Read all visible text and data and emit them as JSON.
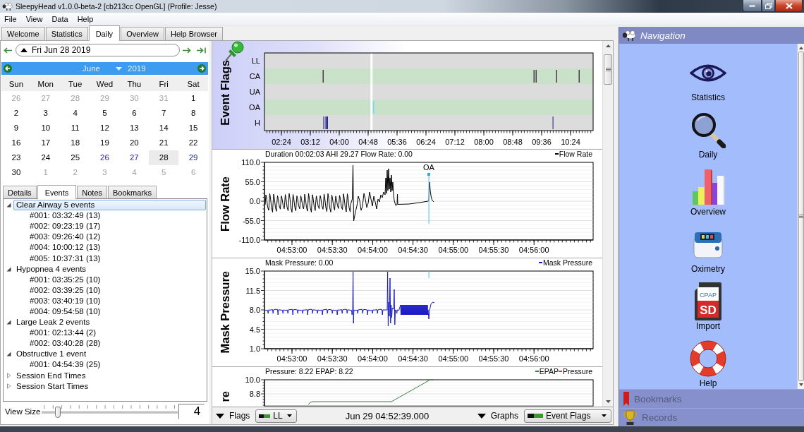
{
  "window": {
    "title": "SleepyHead v1.0.0-beta-2 [cb213cc OpenGL] (Profile: Jesse)"
  },
  "menu": [
    "File",
    "View",
    "Data",
    "Help"
  ],
  "tabs": [
    {
      "label": "Welcome",
      "selected": false
    },
    {
      "label": "Statistics",
      "selected": false
    },
    {
      "label": "Daily",
      "selected": true
    },
    {
      "label": "Overview",
      "selected": false
    },
    {
      "label": "Help Browser",
      "selected": false
    }
  ],
  "date_bar": {
    "date": "Fri Jun 28 2019"
  },
  "calendar": {
    "month": "June",
    "year": "2019",
    "weekdays": [
      "Sun",
      "Mon",
      "Tue",
      "Wed",
      "Thu",
      "Fri",
      "Sat"
    ],
    "weeks": [
      [
        {
          "label": "26",
          "muted": true,
          "has_data": false,
          "selected": false
        },
        {
          "label": "27",
          "muted": true,
          "has_data": false,
          "selected": false
        },
        {
          "label": "28",
          "muted": true,
          "has_data": false,
          "selected": false
        },
        {
          "label": "29",
          "muted": true,
          "has_data": false,
          "selected": false
        },
        {
          "label": "30",
          "muted": true,
          "has_data": false,
          "selected": false
        },
        {
          "label": "31",
          "muted": true,
          "has_data": false,
          "selected": false
        },
        {
          "label": "1",
          "muted": false,
          "has_data": false,
          "selected": false
        }
      ],
      [
        {
          "label": "2",
          "muted": false,
          "has_data": false,
          "selected": false
        },
        {
          "label": "3",
          "muted": false,
          "has_data": false,
          "selected": false
        },
        {
          "label": "4",
          "muted": false,
          "has_data": false,
          "selected": false
        },
        {
          "label": "5",
          "muted": false,
          "has_data": false,
          "selected": false
        },
        {
          "label": "6",
          "muted": false,
          "has_data": false,
          "selected": false
        },
        {
          "label": "7",
          "muted": false,
          "has_data": false,
          "selected": false
        },
        {
          "label": "8",
          "muted": false,
          "has_data": false,
          "selected": false
        }
      ],
      [
        {
          "label": "9",
          "muted": false,
          "has_data": false,
          "selected": false
        },
        {
          "label": "10",
          "muted": false,
          "has_data": false,
          "selected": false
        },
        {
          "label": "11",
          "muted": false,
          "has_data": false,
          "selected": false
        },
        {
          "label": "12",
          "muted": false,
          "has_data": false,
          "selected": false
        },
        {
          "label": "13",
          "muted": false,
          "has_data": false,
          "selected": false
        },
        {
          "label": "14",
          "muted": false,
          "has_data": false,
          "selected": false
        },
        {
          "label": "15",
          "muted": false,
          "has_data": false,
          "selected": false
        }
      ],
      [
        {
          "label": "16",
          "muted": false,
          "has_data": false,
          "selected": false
        },
        {
          "label": "17",
          "muted": false,
          "has_data": false,
          "selected": false
        },
        {
          "label": "18",
          "muted": false,
          "has_data": false,
          "selected": false
        },
        {
          "label": "19",
          "muted": false,
          "has_data": false,
          "selected": false
        },
        {
          "label": "20",
          "muted": false,
          "has_data": false,
          "selected": false
        },
        {
          "label": "21",
          "muted": false,
          "has_data": false,
          "selected": false
        },
        {
          "label": "22",
          "muted": false,
          "has_data": false,
          "selected": false
        }
      ],
      [
        {
          "label": "23",
          "muted": false,
          "has_data": false,
          "selected": false
        },
        {
          "label": "24",
          "muted": false,
          "has_data": false,
          "selected": false
        },
        {
          "label": "25",
          "muted": false,
          "has_data": false,
          "selected": false
        },
        {
          "label": "26",
          "muted": false,
          "has_data": true,
          "selected": false
        },
        {
          "label": "27",
          "muted": false,
          "has_data": true,
          "selected": false
        },
        {
          "label": "28",
          "muted": false,
          "has_data": false,
          "selected": true
        },
        {
          "label": "29",
          "muted": false,
          "has_data": true,
          "selected": false
        }
      ],
      [
        {
          "label": "30",
          "muted": false,
          "has_data": false,
          "selected": false
        },
        {
          "label": "1",
          "muted": true,
          "has_data": false,
          "selected": false
        },
        {
          "label": "2",
          "muted": true,
          "has_data": false,
          "selected": false
        },
        {
          "label": "3",
          "muted": true,
          "has_data": false,
          "selected": false
        },
        {
          "label": "4",
          "muted": true,
          "has_data": false,
          "selected": false
        },
        {
          "label": "5",
          "muted": true,
          "has_data": false,
          "selected": false
        },
        {
          "label": "6",
          "muted": true,
          "has_data": false,
          "selected": false
        }
      ]
    ]
  },
  "detail_tabs": [
    {
      "label": "Details",
      "selected": false
    },
    {
      "label": "Events",
      "selected": true
    },
    {
      "label": "Notes",
      "selected": false
    },
    {
      "label": "Bookmarks",
      "selected": false
    }
  ],
  "events_tree": [
    {
      "label": "Clear Airway 5 events",
      "expanded": true,
      "selected": true,
      "children": [
        {
          "label": "#001: 03:32:49 (13)",
          "selected": false
        },
        {
          "label": "#002: 09:23:19 (17)",
          "selected": false
        },
        {
          "label": "#003: 09:26:40 (12)",
          "selected": false
        },
        {
          "label": "#004: 10:00:12 (13)",
          "selected": false
        },
        {
          "label": "#005: 10:37:31 (13)",
          "selected": false
        }
      ]
    },
    {
      "label": "Hypopnea 4 events",
      "expanded": true,
      "selected": false,
      "children": [
        {
          "label": "#001: 03:35:25 (10)",
          "selected": false
        },
        {
          "label": "#002: 03:39:25 (10)",
          "selected": false
        },
        {
          "label": "#003: 03:40:19 (10)",
          "selected": false
        },
        {
          "label": "#004: 09:54:58 (10)",
          "selected": false
        }
      ]
    },
    {
      "label": "Large Leak 2 events",
      "expanded": true,
      "selected": false,
      "children": [
        {
          "label": "#001: 02:13:44 (2)",
          "selected": false
        },
        {
          "label": "#002: 03:40:28 (28)",
          "selected": false
        }
      ]
    },
    {
      "label": "Obstructive 1 event",
      "expanded": true,
      "selected": false,
      "children": [
        {
          "label": "#001: 04:54:39 (25)",
          "selected": false
        }
      ]
    },
    {
      "label": "Session End Times",
      "expanded": false,
      "selected": false
    },
    {
      "label": "Session Start Times",
      "expanded": false,
      "selected": false
    }
  ],
  "view_size": {
    "label": "View Size",
    "level": 0.1,
    "value": "4"
  },
  "graphs": [
    {
      "kind": "flags",
      "title": "Event Flags",
      "rows": [
        "LL",
        "CA",
        "UA",
        "OA",
        "H"
      ],
      "x_ticks": [
        "02:24",
        "03:12",
        "04:00",
        "04:48",
        "05:36",
        "06:24",
        "07:12",
        "08:00",
        "08:48",
        "09:36",
        "10:24"
      ]
    },
    {
      "kind": "wave",
      "title": "Flow Rate",
      "info": "Duration 00:02:03 AHI 29.27 Flow Rate: 0.00",
      "legend": [
        {
          "label": "Flow Rate",
          "color": "#000000"
        }
      ],
      "y_ticks": [
        "110.0",
        "55.0",
        "0.0",
        "-55.0",
        "-110.0"
      ],
      "x_ticks": [
        "04:53:00",
        "04:53:30",
        "04:54:00",
        "04:54:30",
        "04:55:00",
        "04:55:30",
        "04:56:00"
      ],
      "annotation": "OA"
    },
    {
      "kind": "wave",
      "title": "Mask Pressure",
      "info": "Mask Pressure: 0.00",
      "legend": [
        {
          "label": "Mask Pressure",
          "color": "#1c1cc4"
        }
      ],
      "y_ticks": [
        "15.0",
        "11.5",
        "8.0",
        "4.5",
        "1.0"
      ],
      "x_ticks": [
        "04:53:00",
        "04:53:30",
        "04:54:00",
        "04:54:30",
        "04:55:00",
        "04:55:30",
        "04:56:00"
      ]
    },
    {
      "kind": "wave",
      "title": "re",
      "info": "Pressure: 8.22 EPAP: 8.22",
      "legend": [
        {
          "label": "EPAP",
          "color": "#3e7e3e"
        },
        {
          "label": "Pressure",
          "color": "#c04848"
        }
      ],
      "y_ticks": [
        "10.0",
        "8.8"
      ]
    }
  ],
  "graph_toolbar": {
    "flags_label": "Flags",
    "flags_value": "LL",
    "time": "Jun 29 04:52:39.000",
    "graphs_label": "Graphs",
    "graphs_value": "Event Flags"
  },
  "navigation": {
    "title": "Navigation",
    "items": [
      {
        "label": "Statistics"
      },
      {
        "label": "Daily"
      },
      {
        "label": "Overview"
      },
      {
        "label": "Oximetry"
      },
      {
        "label": "Import",
        "icon_labels": [
          "CPAP",
          "SD"
        ]
      },
      {
        "label": "Help"
      }
    ],
    "sections": [
      "Bookmarks",
      "Records"
    ]
  }
}
